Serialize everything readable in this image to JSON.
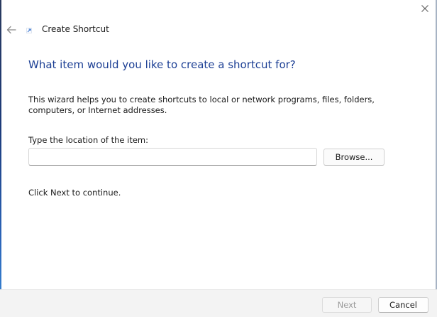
{
  "window": {
    "title": "Create Shortcut",
    "close_icon": "close-icon",
    "back_icon": "arrow-left-icon",
    "app_icon": "shortcut-arrow-icon"
  },
  "page": {
    "heading": "What item would you like to create a shortcut for?",
    "intro": "This wizard helps you to create shortcuts to local or network programs, files, folders, computers, or Internet addresses.",
    "location_label": "Type the location of the item:",
    "location_value": "",
    "browse_label": "Browse...",
    "continue_text": "Click Next to continue."
  },
  "footer": {
    "next_label": "Next",
    "next_enabled": false,
    "cancel_label": "Cancel"
  },
  "colors": {
    "heading": "#1c3f94",
    "footer_bg": "#f3f3f3",
    "disabled_text": "#9b9b9b"
  }
}
